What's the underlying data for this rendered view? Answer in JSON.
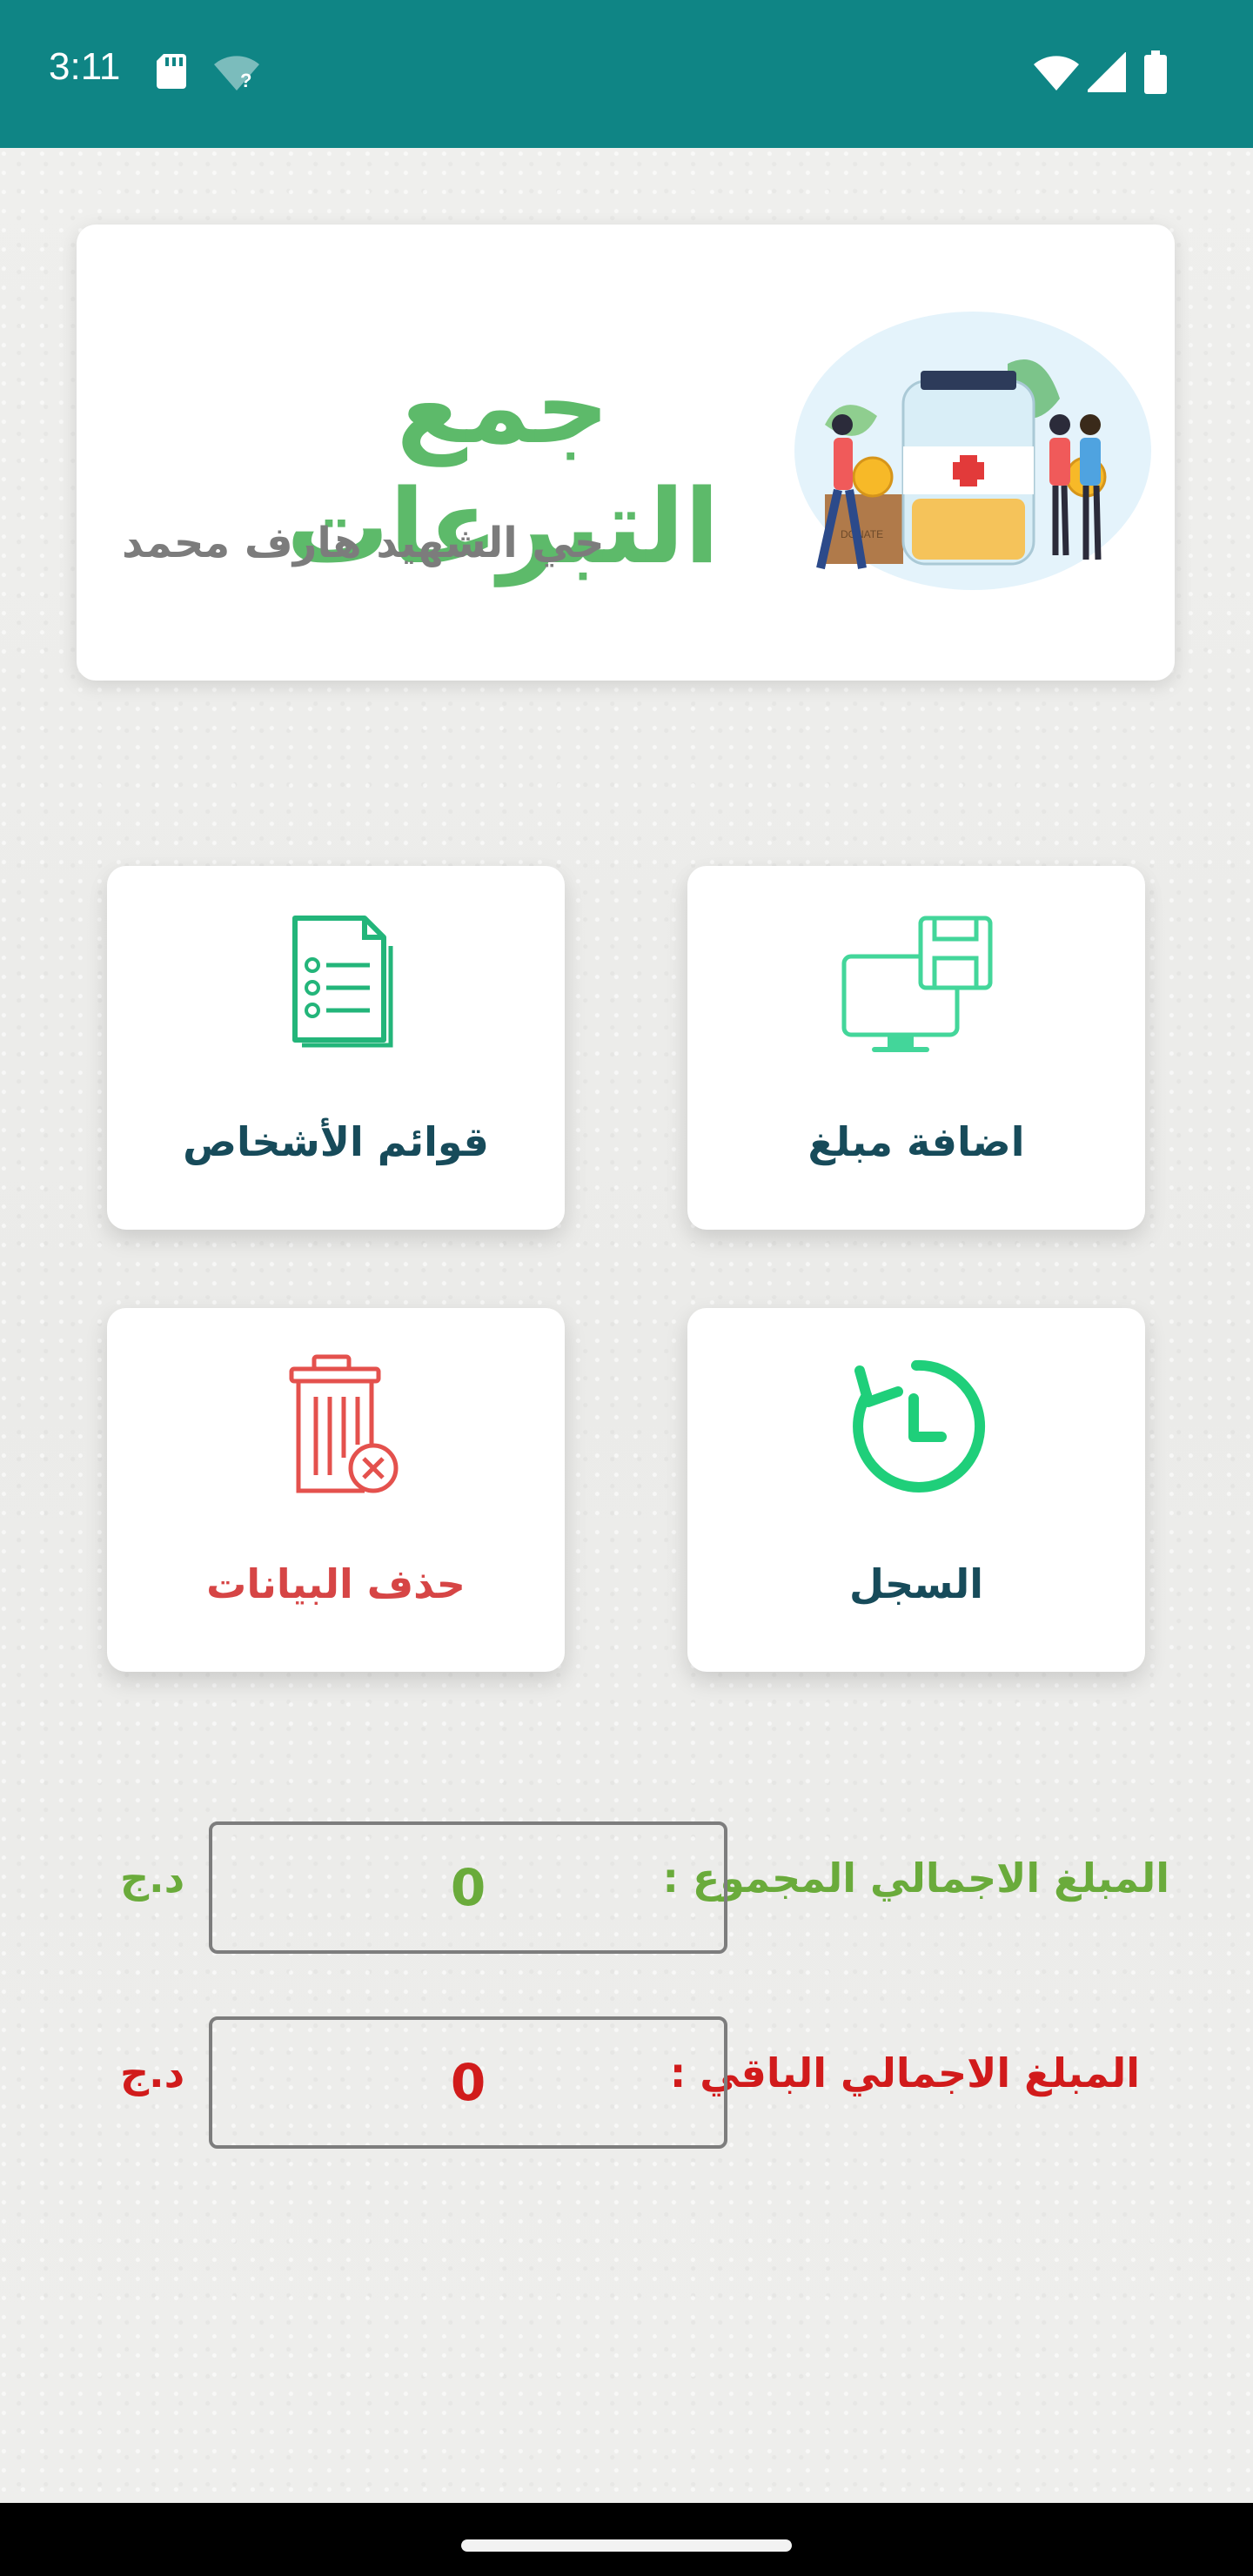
{
  "status_bar": {
    "time": "3:11",
    "icons": [
      "sd-card-icon",
      "wifi-question-icon",
      "wifi-icon",
      "signal-icon",
      "battery-icon"
    ],
    "background": "#0f8585"
  },
  "header": {
    "title": "جمع التبرعات",
    "subtitle": "حي الشهيد هارف محمد",
    "illustration": "donation-jar-illustration"
  },
  "tiles": [
    {
      "label": "اضافة مبلغ",
      "icon": "computer-save-icon",
      "color": "#174b5a"
    },
    {
      "label": "قوائم الأشخاص",
      "icon": "list-document-icon",
      "color": "#174b5a"
    },
    {
      "label": "السجل",
      "icon": "history-clock-icon",
      "color": "#174b5a"
    },
    {
      "label": "حذف البيانات",
      "icon": "delete-trash-icon",
      "color": "#d64545"
    }
  ],
  "totals": {
    "collected": {
      "label": "المبلغ الاجمالي المجموع :",
      "value": "0",
      "currency": "د.ج",
      "color": "#6aab3b"
    },
    "remaining": {
      "label": "المبلغ الاجمالي الباقي :",
      "value": "0",
      "currency": "د.ج",
      "color": "#d11b1b"
    }
  }
}
